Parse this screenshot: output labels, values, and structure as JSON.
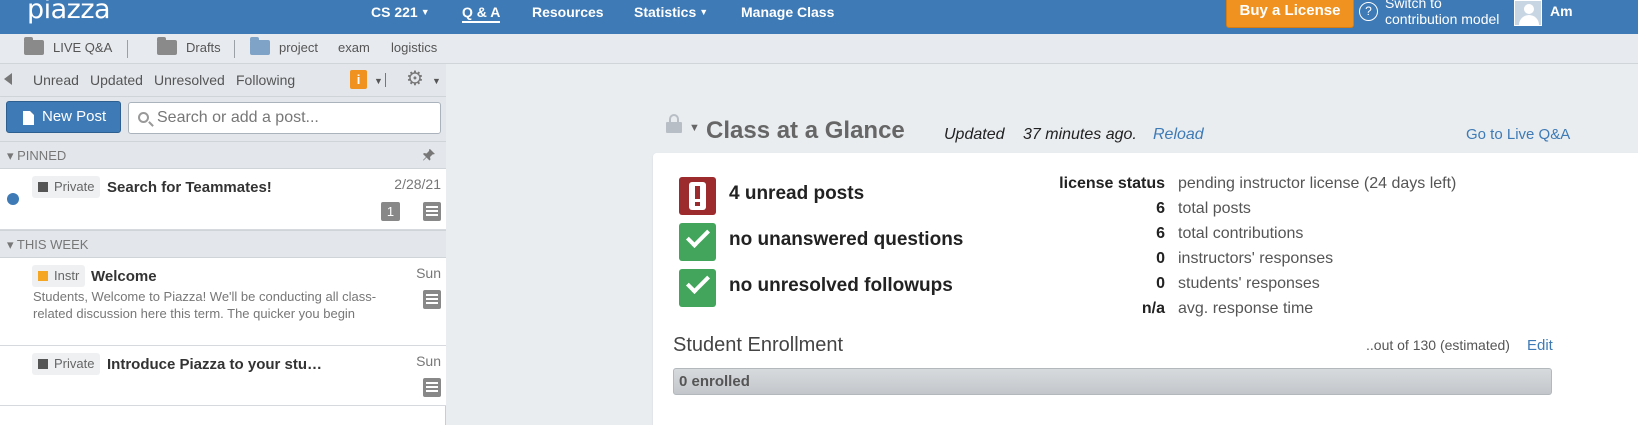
{
  "app": {
    "logo": "piazza"
  },
  "topnav": {
    "course": "CS 221",
    "qa": "Q & A",
    "resources": "Resources",
    "statistics": "Statistics",
    "manage": "Manage Class",
    "buy_license": "Buy a License",
    "switch_line1": "Switch to",
    "switch_line2": "contribution model",
    "user_initials": "Am"
  },
  "folders": [
    "LIVE Q&A",
    "Drafts",
    "project",
    "exam",
    "logistics"
  ],
  "filters": {
    "unread": "Unread",
    "updated": "Updated",
    "unresolved": "Unresolved",
    "following": "Following",
    "info_badge": "i"
  },
  "search": {
    "new_post": "New Post",
    "placeholder": "Search or add a post..."
  },
  "sections": {
    "pinned": "PINNED",
    "this_week": "THIS WEEK"
  },
  "posts": [
    {
      "tag": "Private",
      "title": "Search for Teammates!",
      "date": "2/28/21",
      "snippet": "",
      "count": "1",
      "unread": true
    },
    {
      "tag": "Instr",
      "title": "Welcome",
      "date": "Sun",
      "snippet": "Students, Welcome to Piazza! We'll be conducting all class-related discussion here this term. The quicker you begin"
    },
    {
      "tag": "Private",
      "title": "Introduce Piazza to your stu…",
      "date": "Sun",
      "snippet": ""
    }
  ],
  "glance": {
    "title": "Class at a Glance",
    "updated": "Updated",
    "ago": "37 minutes ago.",
    "reload": "Reload",
    "goto_live": "Go to Live Q&A",
    "status": [
      {
        "text": "4 unread posts",
        "kind": "alert"
      },
      {
        "text": "no unanswered questions",
        "kind": "ok"
      },
      {
        "text": "no unresolved followups",
        "kind": "ok"
      }
    ],
    "stats": [
      {
        "value": "license status",
        "label": "pending instructor license (24 days left)"
      },
      {
        "value": "6",
        "label": "total posts"
      },
      {
        "value": "6",
        "label": "total contributions"
      },
      {
        "value": "0",
        "label": "instructors' responses"
      },
      {
        "value": "0",
        "label": "students' responses"
      },
      {
        "value": "n/a",
        "label": "avg. response time"
      }
    ]
  },
  "enrollment": {
    "title": "Student Enrollment",
    "out_of": "..out of 130 (estimated)",
    "edit": "Edit",
    "enrolled_label": "0 enrolled",
    "enrolled_fraction": 0
  },
  "colors": {
    "brand_blue": "#3e7ab5",
    "accent_orange": "#f09220",
    "alert_red": "#9b2b2d",
    "ok_green": "#43a55b"
  },
  "icons": [
    "gear-icon",
    "search-icon",
    "pin-icon",
    "lock-icon",
    "help-icon",
    "folder-icon",
    "note-icon"
  ]
}
